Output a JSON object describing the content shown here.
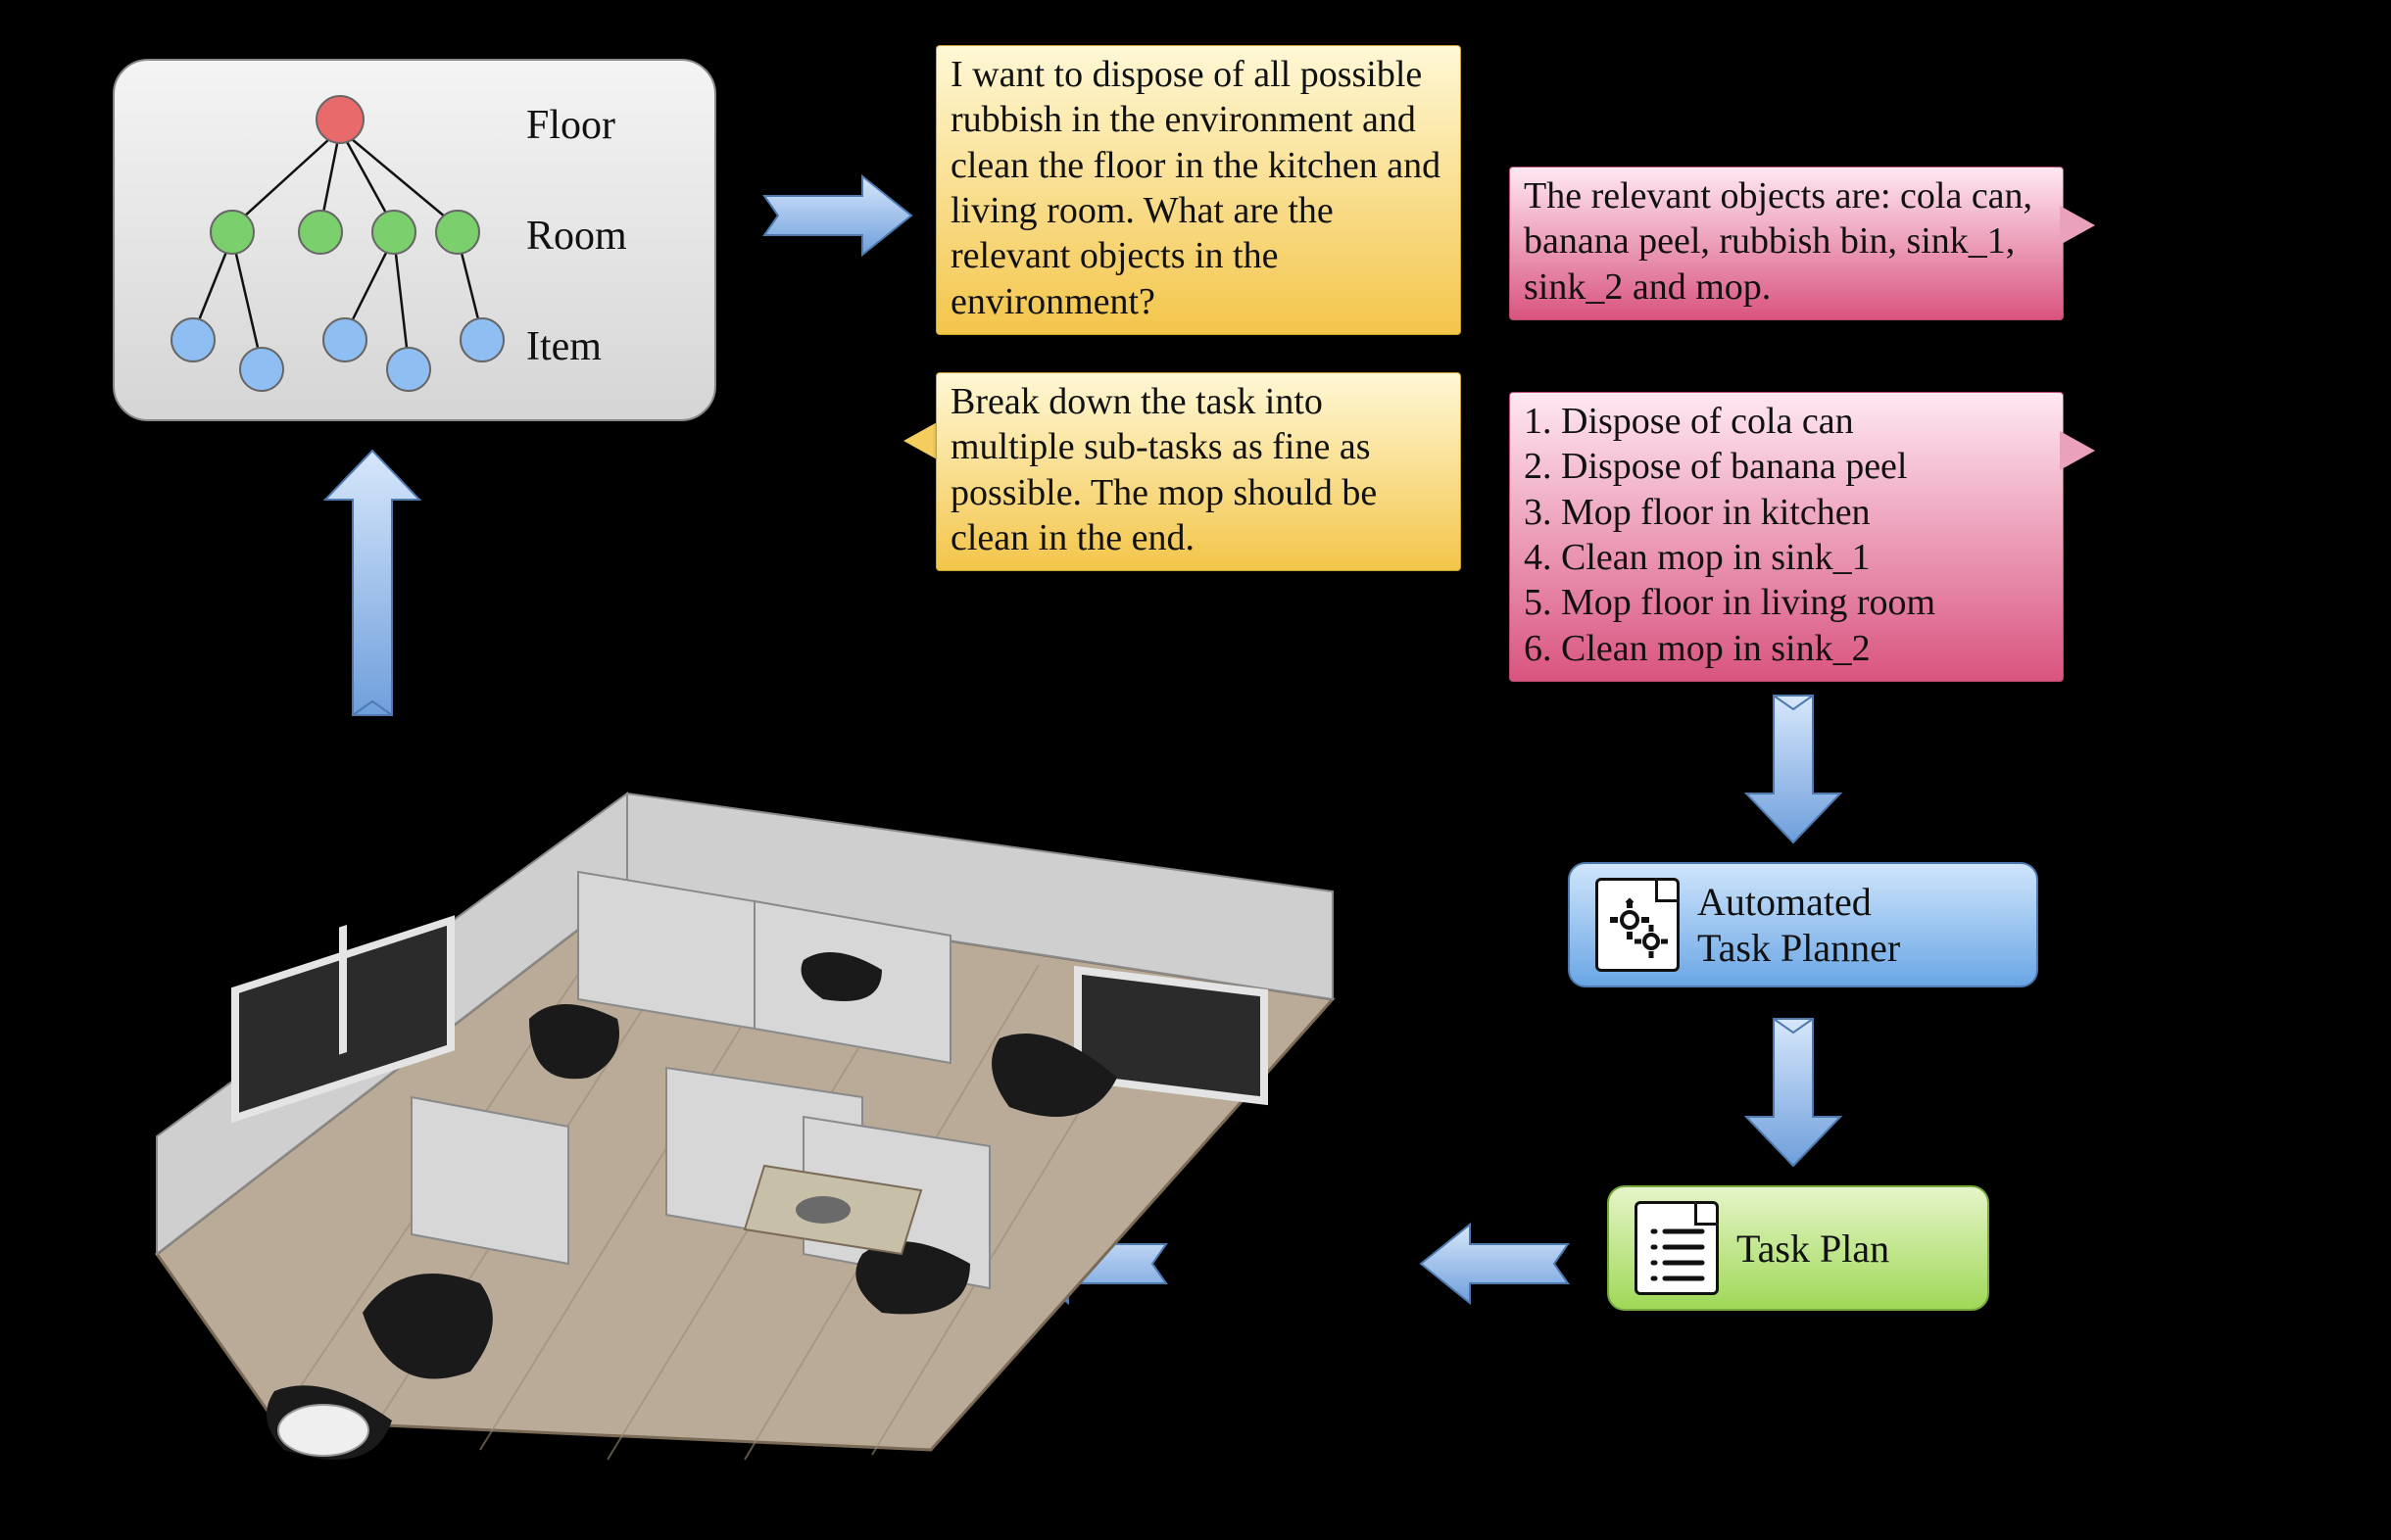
{
  "tree": {
    "labels": {
      "floor": "Floor",
      "room": "Room",
      "item": "Item"
    },
    "colors": {
      "floor": "#e86a6a",
      "room": "#7bcf6c",
      "item": "#8fbff2"
    }
  },
  "prompts": {
    "query": "I want to dispose of all possible rubbish in the environment and clean the floor in the kitchen and living room. What are the relevant objects in the environment?",
    "breakdown": "Break down the task into multiple sub-tasks as fine as possible. The mop should be clean in the end."
  },
  "responses": {
    "objects": "The relevant objects are: cola can, banana peel, rubbish bin, sink_1, sink_2 and mop.",
    "subtasks": [
      "1. Dispose of cola can",
      "2. Dispose of banana peel",
      "3. Mop floor in kitchen",
      "4. Clean mop in sink_1",
      "5. Mop floor in living room",
      "6. Clean mop in sink_2"
    ]
  },
  "modules": {
    "planner": "Automated\nTask Planner",
    "plan": "Task Plan"
  }
}
